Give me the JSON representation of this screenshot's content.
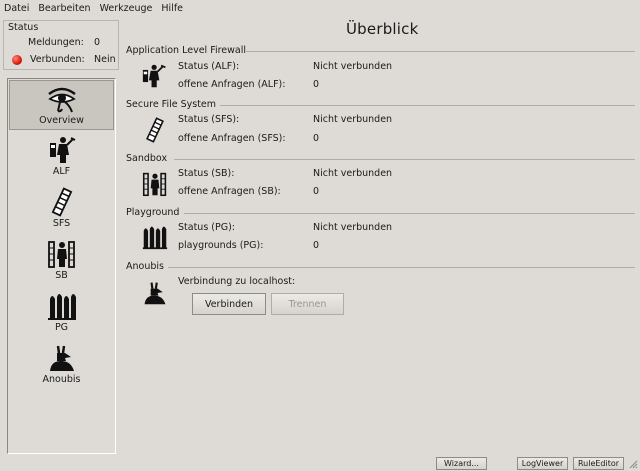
{
  "menu": [
    "Datei",
    "Bearbeiten",
    "Werkzeuge",
    "Hilfe"
  ],
  "status": {
    "title": "Status",
    "meldungen_label": "Meldungen:",
    "meldungen_value": "0",
    "verbunden_label": "Verbunden:",
    "verbunden_value": "Nein",
    "led_color": "#d81a0a"
  },
  "sidebar": {
    "items": [
      {
        "label": "Overview",
        "icon": "eye-icon"
      },
      {
        "label": "ALF",
        "icon": "alf-figure-icon"
      },
      {
        "label": "SFS",
        "icon": "sfs-pillar-icon"
      },
      {
        "label": "SB",
        "icon": "sandbox-figure-icon"
      },
      {
        "label": "PG",
        "icon": "playground-columns-icon"
      },
      {
        "label": "Anoubis",
        "icon": "anoubis-jackal-icon"
      }
    ]
  },
  "main": {
    "title": "Überblick",
    "sections": [
      {
        "title": "Application Level Firewall",
        "rows": [
          {
            "label": "Status (ALF):",
            "value": "Nicht verbunden"
          },
          {
            "label": "offene Anfragen (ALF):",
            "value": "0"
          }
        ]
      },
      {
        "title": "Secure File System",
        "rows": [
          {
            "label": "Status (SFS):",
            "value": "Nicht verbunden"
          },
          {
            "label": "offene Anfragen (SFS):",
            "value": "0"
          }
        ]
      },
      {
        "title": "Sandbox",
        "rows": [
          {
            "label": "Status (SB):",
            "value": "Nicht verbunden"
          },
          {
            "label": "offene Anfragen (SB):",
            "value": "0"
          }
        ]
      },
      {
        "title": "Playground",
        "rows": [
          {
            "label": "Status (PG):",
            "value": "Nicht verbunden"
          },
          {
            "label": "playgrounds (PG):",
            "value": "0"
          }
        ]
      }
    ],
    "anoubis": {
      "title": "Anoubis",
      "connection_label": "Verbindung zu localhost:",
      "connect_button": "Verbinden",
      "disconnect_button": "Trennen"
    }
  },
  "statusbar": {
    "wizard": "Wizard...",
    "logviewer": "LogViewer",
    "ruleeditor": "RuleEditor"
  }
}
